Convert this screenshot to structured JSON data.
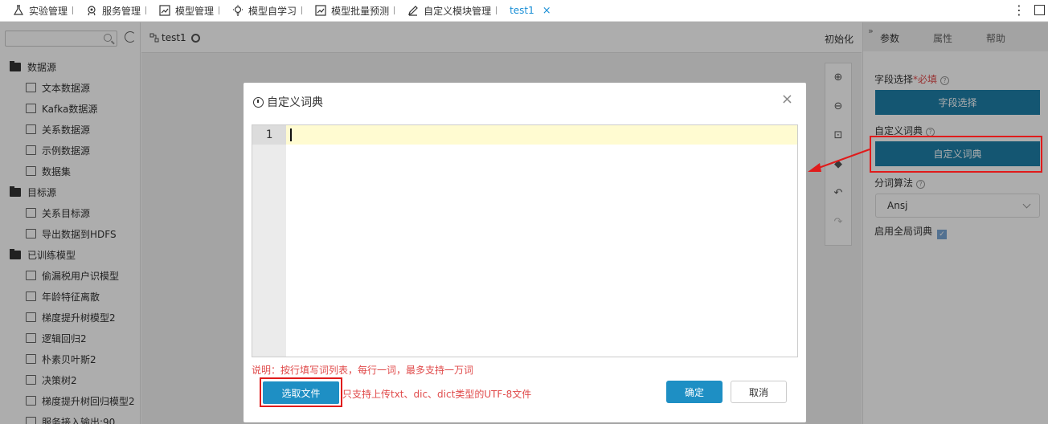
{
  "tabs": [
    {
      "label": "实验管理",
      "icon": "flask-icon"
    },
    {
      "label": "服务管理",
      "icon": "service-icon"
    },
    {
      "label": "模型管理",
      "icon": "chart-icon"
    },
    {
      "label": "模型自学习",
      "icon": "bulb-icon"
    },
    {
      "label": "模型批量预测",
      "icon": "chart-icon"
    },
    {
      "label": "自定义模块管理",
      "icon": "pen-icon"
    },
    {
      "label": "test1",
      "icon": ""
    }
  ],
  "sidebar": {
    "groups": [
      {
        "label": "数据源",
        "items": [
          "文本数据源",
          "Kafka数据源",
          "关系数据源",
          "示例数据源",
          "数据集"
        ]
      },
      {
        "label": "目标源",
        "items": [
          "关系目标源",
          "导出数据到HDFS"
        ]
      },
      {
        "label": "已训练模型",
        "items": [
          "偷漏税用户识模型",
          "年龄特征离散",
          "梯度提升树模型2",
          "逻辑回归2",
          "朴素贝叶斯2",
          "决策树2",
          "梯度提升树回归模型2",
          "服务接入输出:90"
        ]
      }
    ]
  },
  "center": {
    "title": "test1",
    "init_label": "初始化"
  },
  "right_panel": {
    "tabs": [
      "参数",
      "属性",
      "帮助"
    ],
    "field_select_label": "字段选择",
    "required_mark": "*必填",
    "field_select_button": "字段选择",
    "custom_dict_label": "自定义词典",
    "custom_dict_button": "自定义词典",
    "algo_label": "分词算法",
    "algo_value": "Ansj",
    "global_dict_label": "启用全局词典"
  },
  "dialog": {
    "title": "自定义词典",
    "line_number": "1",
    "note": "说明：按行填写词列表，每行一词，最多支持一万词",
    "pick_button": "选取文件",
    "pick_note": "只支持上传txt、dic、dict类型的UTF-8文件",
    "ok_button": "确定",
    "cancel_button": "取消"
  },
  "colors": {
    "accent": "#1e8fc4",
    "highlight": "#e01b1b"
  }
}
